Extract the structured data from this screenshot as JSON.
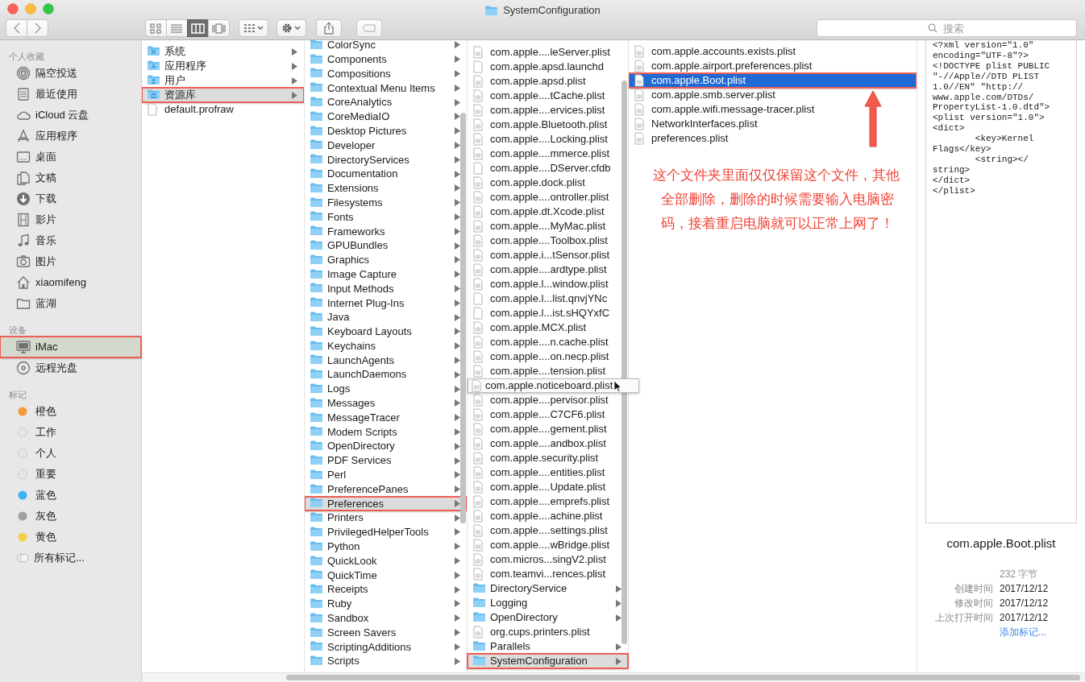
{
  "window": {
    "title": "SystemConfiguration"
  },
  "toolbar": {
    "view_modes": [
      {
        "kind": "icons",
        "selected": false
      },
      {
        "kind": "list",
        "selected": false
      },
      {
        "kind": "columns",
        "selected": true
      },
      {
        "kind": "coverflow",
        "selected": false
      }
    ],
    "search": {
      "placeholder": "搜索"
    }
  },
  "sidebar": {
    "sections": [
      {
        "heading": "个人收藏",
        "items": [
          {
            "label": "隔空投送",
            "kind": "airdrop",
            "selected": false,
            "marked": false
          },
          {
            "label": "最近使用",
            "kind": "recent",
            "selected": false,
            "marked": false
          },
          {
            "label": "iCloud 云盘",
            "kind": "cloud",
            "selected": false,
            "marked": false
          },
          {
            "label": "应用程序",
            "kind": "apps",
            "selected": false,
            "marked": false
          },
          {
            "label": "桌面",
            "kind": "desktop",
            "selected": false,
            "marked": false
          },
          {
            "label": "文稿",
            "kind": "documents",
            "selected": false,
            "marked": false
          },
          {
            "label": "下载",
            "kind": "download",
            "selected": false,
            "marked": false
          },
          {
            "label": "影片",
            "kind": "movies",
            "selected": false,
            "marked": false
          },
          {
            "label": "音乐",
            "kind": "music",
            "selected": false,
            "marked": false
          },
          {
            "label": "图片",
            "kind": "pictures",
            "selected": false,
            "marked": false
          },
          {
            "label": "xiaomifeng",
            "kind": "home",
            "selected": false,
            "marked": false
          },
          {
            "label": "蓝湖",
            "kind": "folder",
            "selected": false,
            "marked": false
          }
        ]
      },
      {
        "heading": "设备",
        "items": [
          {
            "label": "iMac",
            "kind": "computer",
            "selected": true,
            "marked": true
          },
          {
            "label": "远程光盘",
            "kind": "disc",
            "selected": false,
            "marked": false
          }
        ]
      },
      {
        "heading": "标记",
        "items": [
          {
            "label": "橙色",
            "kind": "tag",
            "color": "#f39a3c",
            "selected": false,
            "marked": false
          },
          {
            "label": "工作",
            "kind": "tag",
            "color": "#e6e6e6",
            "selected": false,
            "marked": false
          },
          {
            "label": "个人",
            "kind": "tag",
            "color": "#e6e6e6",
            "selected": false,
            "marked": false
          },
          {
            "label": "重要",
            "kind": "tag",
            "color": "#e6e6e6",
            "selected": false,
            "marked": false
          },
          {
            "label": "蓝色",
            "kind": "tag",
            "color": "#3fb1f5",
            "selected": false,
            "marked": false
          },
          {
            "label": "灰色",
            "kind": "tag",
            "color": "#a0a0a4",
            "selected": false,
            "marked": false
          },
          {
            "label": "黄色",
            "kind": "tag",
            "color": "#f7cd48",
            "selected": false,
            "marked": false
          },
          {
            "label": "所有标记...",
            "kind": "all-tags",
            "selected": false,
            "marked": false
          }
        ]
      }
    ]
  },
  "columns": [
    {
      "items": [
        {
          "label": "系统",
          "kind": "system-folder",
          "selected": false,
          "marked": false
        },
        {
          "label": "应用程序",
          "kind": "apps-folder",
          "selected": false,
          "marked": false
        },
        {
          "label": "用户",
          "kind": "users-folder",
          "selected": false,
          "marked": false
        },
        {
          "label": "资源库",
          "kind": "library-folder",
          "selected": true,
          "marked": true
        },
        {
          "label": "default.profraw",
          "kind": "file",
          "selected": false,
          "marked": false
        }
      ]
    },
    {
      "items": [
        {
          "label": "ColorSync",
          "kind": "folder",
          "selected": false,
          "marked": false
        },
        {
          "label": "Components",
          "kind": "folder",
          "selected": false,
          "marked": false
        },
        {
          "label": "Compositions",
          "kind": "folder",
          "selected": false,
          "marked": false
        },
        {
          "label": "Contextual Menu Items",
          "kind": "folder",
          "selected": false,
          "marked": false
        },
        {
          "label": "CoreAnalytics",
          "kind": "folder",
          "selected": false,
          "marked": false
        },
        {
          "label": "CoreMediaIO",
          "kind": "folder",
          "selected": false,
          "marked": false
        },
        {
          "label": "Desktop Pictures",
          "kind": "folder",
          "selected": false,
          "marked": false
        },
        {
          "label": "Developer",
          "kind": "folder",
          "selected": false,
          "marked": false
        },
        {
          "label": "DirectoryServices",
          "kind": "folder",
          "selected": false,
          "marked": false
        },
        {
          "label": "Documentation",
          "kind": "folder",
          "selected": false,
          "marked": false
        },
        {
          "label": "Extensions",
          "kind": "folder",
          "selected": false,
          "marked": false
        },
        {
          "label": "Filesystems",
          "kind": "folder",
          "selected": false,
          "marked": false
        },
        {
          "label": "Fonts",
          "kind": "folder",
          "selected": false,
          "marked": false
        },
        {
          "label": "Frameworks",
          "kind": "folder",
          "selected": false,
          "marked": false
        },
        {
          "label": "GPUBundles",
          "kind": "folder",
          "selected": false,
          "marked": false
        },
        {
          "label": "Graphics",
          "kind": "folder",
          "selected": false,
          "marked": false
        },
        {
          "label": "Image Capture",
          "kind": "folder",
          "selected": false,
          "marked": false
        },
        {
          "label": "Input Methods",
          "kind": "folder",
          "selected": false,
          "marked": false
        },
        {
          "label": "Internet Plug-Ins",
          "kind": "folder",
          "selected": false,
          "marked": false
        },
        {
          "label": "Java",
          "kind": "folder",
          "selected": false,
          "marked": false
        },
        {
          "label": "Keyboard Layouts",
          "kind": "folder",
          "selected": false,
          "marked": false
        },
        {
          "label": "Keychains",
          "kind": "folder",
          "selected": false,
          "marked": false
        },
        {
          "label": "LaunchAgents",
          "kind": "folder",
          "selected": false,
          "marked": false
        },
        {
          "label": "LaunchDaemons",
          "kind": "folder",
          "selected": false,
          "marked": false
        },
        {
          "label": "Logs",
          "kind": "folder",
          "selected": false,
          "marked": false
        },
        {
          "label": "Messages",
          "kind": "folder",
          "selected": false,
          "marked": false
        },
        {
          "label": "MessageTracer",
          "kind": "folder",
          "selected": false,
          "marked": false
        },
        {
          "label": "Modem Scripts",
          "kind": "folder",
          "selected": false,
          "marked": false
        },
        {
          "label": "OpenDirectory",
          "kind": "folder",
          "selected": false,
          "marked": false
        },
        {
          "label": "PDF Services",
          "kind": "folder",
          "selected": false,
          "marked": false
        },
        {
          "label": "Perl",
          "kind": "folder",
          "selected": false,
          "marked": false
        },
        {
          "label": "PreferencePanes",
          "kind": "folder",
          "selected": false,
          "marked": false
        },
        {
          "label": "Preferences",
          "kind": "folder",
          "selected": true,
          "marked": true
        },
        {
          "label": "Printers",
          "kind": "folder",
          "selected": false,
          "marked": false
        },
        {
          "label": "PrivilegedHelperTools",
          "kind": "folder",
          "selected": false,
          "marked": false
        },
        {
          "label": "Python",
          "kind": "folder",
          "selected": false,
          "marked": false
        },
        {
          "label": "QuickLook",
          "kind": "folder",
          "selected": false,
          "marked": false
        },
        {
          "label": "QuickTime",
          "kind": "folder",
          "selected": false,
          "marked": false
        },
        {
          "label": "Receipts",
          "kind": "folder",
          "selected": false,
          "marked": false
        },
        {
          "label": "Ruby",
          "kind": "folder",
          "selected": false,
          "marked": false
        },
        {
          "label": "Sandbox",
          "kind": "folder",
          "selected": false,
          "marked": false
        },
        {
          "label": "Screen Savers",
          "kind": "folder",
          "selected": false,
          "marked": false
        },
        {
          "label": "ScriptingAdditions",
          "kind": "folder",
          "selected": false,
          "marked": false
        },
        {
          "label": "Scripts",
          "kind": "folder",
          "selected": false,
          "marked": false
        }
      ]
    },
    {
      "items": [
        {
          "label": "com.apple....leServer.plist",
          "kind": "plist",
          "selected": false,
          "marked": false,
          "expanded": false
        },
        {
          "label": "com.apple.apsd.launchd",
          "kind": "file",
          "selected": false,
          "marked": false,
          "expanded": false
        },
        {
          "label": "com.apple.apsd.plist",
          "kind": "plist",
          "selected": false,
          "marked": false,
          "expanded": false
        },
        {
          "label": "com.apple....tCache.plist",
          "kind": "plist",
          "selected": false,
          "marked": false,
          "expanded": false
        },
        {
          "label": "com.apple....ervices.plist",
          "kind": "plist",
          "selected": false,
          "marked": false,
          "expanded": false
        },
        {
          "label": "com.apple.Bluetooth.plist",
          "kind": "plist",
          "selected": false,
          "marked": false,
          "expanded": false
        },
        {
          "label": "com.apple....Locking.plist",
          "kind": "plist",
          "selected": false,
          "marked": false,
          "expanded": false
        },
        {
          "label": "com.apple....mmerce.plist",
          "kind": "plist",
          "selected": false,
          "marked": false,
          "expanded": false
        },
        {
          "label": "com.apple....DServer.cfdb",
          "kind": "file",
          "selected": false,
          "marked": false,
          "expanded": false
        },
        {
          "label": "com.apple.dock.plist",
          "kind": "plist",
          "selected": false,
          "marked": false,
          "expanded": false
        },
        {
          "label": "com.apple....ontroller.plist",
          "kind": "plist",
          "selected": false,
          "marked": false,
          "expanded": false
        },
        {
          "label": "com.apple.dt.Xcode.plist",
          "kind": "plist",
          "selected": false,
          "marked": false,
          "expanded": false
        },
        {
          "label": "com.apple....MyMac.plist",
          "kind": "plist",
          "selected": false,
          "marked": false,
          "expanded": false
        },
        {
          "label": "com.apple....Toolbox.plist",
          "kind": "plist",
          "selected": false,
          "marked": false,
          "expanded": false
        },
        {
          "label": "com.apple.i...tSensor.plist",
          "kind": "plist",
          "selected": false,
          "marked": false,
          "expanded": false
        },
        {
          "label": "com.apple....ardtype.plist",
          "kind": "plist",
          "selected": false,
          "marked": false,
          "expanded": false
        },
        {
          "label": "com.apple.l...window.plist",
          "kind": "plist",
          "selected": false,
          "marked": false,
          "expanded": false
        },
        {
          "label": "com.apple.l...list.qnvjYNc",
          "kind": "file",
          "selected": false,
          "marked": false,
          "expanded": false
        },
        {
          "label": "com.apple.l...ist.sHQYxfC",
          "kind": "file",
          "selected": false,
          "marked": false,
          "expanded": false
        },
        {
          "label": "com.apple.MCX.plist",
          "kind": "plist",
          "selected": false,
          "marked": false,
          "expanded": false
        },
        {
          "label": "com.apple....n.cache.plist",
          "kind": "plist",
          "selected": false,
          "marked": false,
          "expanded": false
        },
        {
          "label": "com.apple....on.necp.plist",
          "kind": "plist",
          "selected": false,
          "marked": false,
          "expanded": false
        },
        {
          "label": "com.apple....tension.plist",
          "kind": "plist",
          "selected": false,
          "marked": false,
          "expanded": false
        },
        {
          "label": "com.apple.noticeboard.plist",
          "kind": "plist",
          "selected": false,
          "marked": false,
          "expanded": true
        },
        {
          "label": "com.apple....pervisor.plist",
          "kind": "plist",
          "selected": false,
          "marked": false,
          "expanded": false
        },
        {
          "label": "com.apple....C7CF6.plist",
          "kind": "plist",
          "selected": false,
          "marked": false,
          "expanded": false
        },
        {
          "label": "com.apple....gement.plist",
          "kind": "plist",
          "selected": false,
          "marked": false,
          "expanded": false
        },
        {
          "label": "com.apple....andbox.plist",
          "kind": "plist",
          "selected": false,
          "marked": false,
          "expanded": false
        },
        {
          "label": "com.apple.security.plist",
          "kind": "plist",
          "selected": false,
          "marked": false,
          "expanded": false
        },
        {
          "label": "com.apple....entities.plist",
          "kind": "plist",
          "selected": false,
          "marked": false,
          "expanded": false
        },
        {
          "label": "com.apple....Update.plist",
          "kind": "plist",
          "selected": false,
          "marked": false,
          "expanded": false
        },
        {
          "label": "com.apple....emprefs.plist",
          "kind": "plist",
          "selected": false,
          "marked": false,
          "expanded": false
        },
        {
          "label": "com.apple....achine.plist",
          "kind": "plist",
          "selected": false,
          "marked": false,
          "expanded": false
        },
        {
          "label": "com.apple....settings.plist",
          "kind": "plist",
          "selected": false,
          "marked": false,
          "expanded": false
        },
        {
          "label": "com.apple....wBridge.plist",
          "kind": "plist",
          "selected": false,
          "marked": false,
          "expanded": false
        },
        {
          "label": "com.micros...singV2.plist",
          "kind": "plist",
          "selected": false,
          "marked": false,
          "expanded": false
        },
        {
          "label": "com.teamvi...rences.plist",
          "kind": "plist",
          "selected": false,
          "marked": false,
          "expanded": false
        },
        {
          "label": "DirectoryService",
          "kind": "folder",
          "selected": false,
          "marked": false,
          "expanded": false
        },
        {
          "label": "Logging",
          "kind": "folder",
          "selected": false,
          "marked": false,
          "expanded": false
        },
        {
          "label": "OpenDirectory",
          "kind": "folder",
          "selected": false,
          "marked": false,
          "expanded": false
        },
        {
          "label": "org.cups.printers.plist",
          "kind": "plist",
          "selected": false,
          "marked": false,
          "expanded": false
        },
        {
          "label": "Parallels",
          "kind": "folder",
          "selected": false,
          "marked": false,
          "expanded": false
        },
        {
          "label": "SystemConfiguration",
          "kind": "folder",
          "selected": true,
          "marked": true,
          "expanded": false
        }
      ]
    },
    {
      "items": [
        {
          "label": "com.apple.accounts.exists.plist",
          "kind": "plist",
          "selected": false,
          "marked": false
        },
        {
          "label": "com.apple.airport.preferences.plist",
          "kind": "plist",
          "selected": false,
          "marked": false
        },
        {
          "label": "com.apple.Boot.plist",
          "kind": "plist",
          "selected": true,
          "marked": true
        },
        {
          "label": "com.apple.smb.server.plist",
          "kind": "plist",
          "selected": false,
          "marked": false
        },
        {
          "label": "com.apple.wifi.message-tracer.plist",
          "kind": "plist",
          "selected": false,
          "marked": false
        },
        {
          "label": "NetworkInterfaces.plist",
          "kind": "plist",
          "selected": false,
          "marked": false
        },
        {
          "label": "preferences.plist",
          "kind": "plist",
          "selected": false,
          "marked": false
        }
      ]
    }
  ],
  "annotation": {
    "lines": [
      "这个文件夹里面仅仅保留这个文件，其他",
      "全部删除，删除的时候需要输入电脑密",
      "码，接着重启电脑就可以正常上网了！"
    ]
  },
  "preview": {
    "content": "<?xml version=\"1.0\"\nencoding=\"UTF-8\"?>\n<!DOCTYPE plist PUBLIC\n\"-//Apple//DTD PLIST\n1.0//EN\" \"http://\nwww.apple.com/DTDs/\nPropertyList-1.0.dtd\">\n<plist version=\"1.0\">\n<dict>\n\t<key>Kernel\nFlags</key>\n\t<string></\nstring>\n</dict>\n</plist>",
    "filename": "com.apple.Boot.plist",
    "size": "232 字节",
    "info": [
      {
        "label": "创建时间",
        "value": "2017/12/12"
      },
      {
        "label": "修改时间",
        "value": "2017/12/12"
      },
      {
        "label": "上次打开时间",
        "value": "2017/12/12"
      }
    ],
    "add_tags": "添加标记..."
  }
}
